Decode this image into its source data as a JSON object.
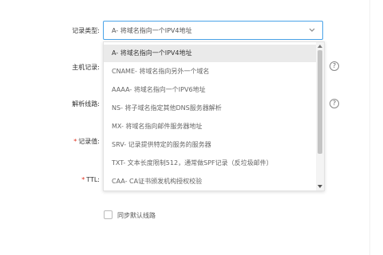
{
  "form": {
    "record_type_label": "记录类型:",
    "host_label": "主机记录:",
    "line_label": "解析线路:",
    "value_label": "记录值:",
    "ttl_label": "TTL:",
    "required_mark": "*"
  },
  "record_type_select": {
    "selected": "A- 将域名指向一个IPV4地址",
    "icon": "chevron-down-icon"
  },
  "dropdown": {
    "options": [
      "A- 将域名指向一个IPV4地址",
      "CNAME- 将域名指向另外一个域名",
      "AAAA- 将域名指向一个IPV6地址",
      "NS- 将子域名指定其他DNS服务器解析",
      "MX- 将域名指向邮件服务器地址",
      "SRV- 记录提供特定的服务的服务器",
      "TXT- 文本长度限制512，通常做SPF记录（反垃圾邮件）",
      "CAA- CA证书颁发机构授权校验"
    ]
  },
  "help_icon_glyph": "?",
  "sync_checkbox": {
    "label": "同步默认线路",
    "checked": false
  },
  "colors": {
    "focus_border": "#4aa3e8",
    "selected_option_bg": "#eaeaea",
    "required": "#e0301e"
  }
}
